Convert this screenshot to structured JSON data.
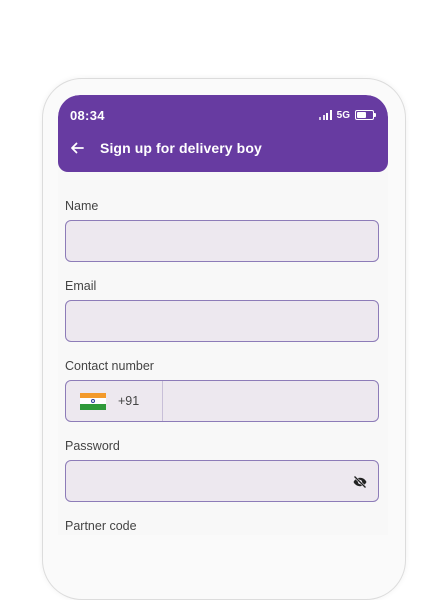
{
  "status_bar": {
    "time": "08:34",
    "network": "5G"
  },
  "header": {
    "title": "Sign up for delivery boy"
  },
  "colors": {
    "primary": "#673ba1",
    "input_bg": "#ede8ef",
    "input_border": "#8d7cb8"
  },
  "form": {
    "name_label": "Name",
    "name_value": "",
    "email_label": "Email",
    "email_value": "",
    "contact_label": "Contact number",
    "country_code": "+91",
    "contact_value": "",
    "password_label": "Password",
    "password_value": "",
    "partner_label": "Partner code"
  }
}
